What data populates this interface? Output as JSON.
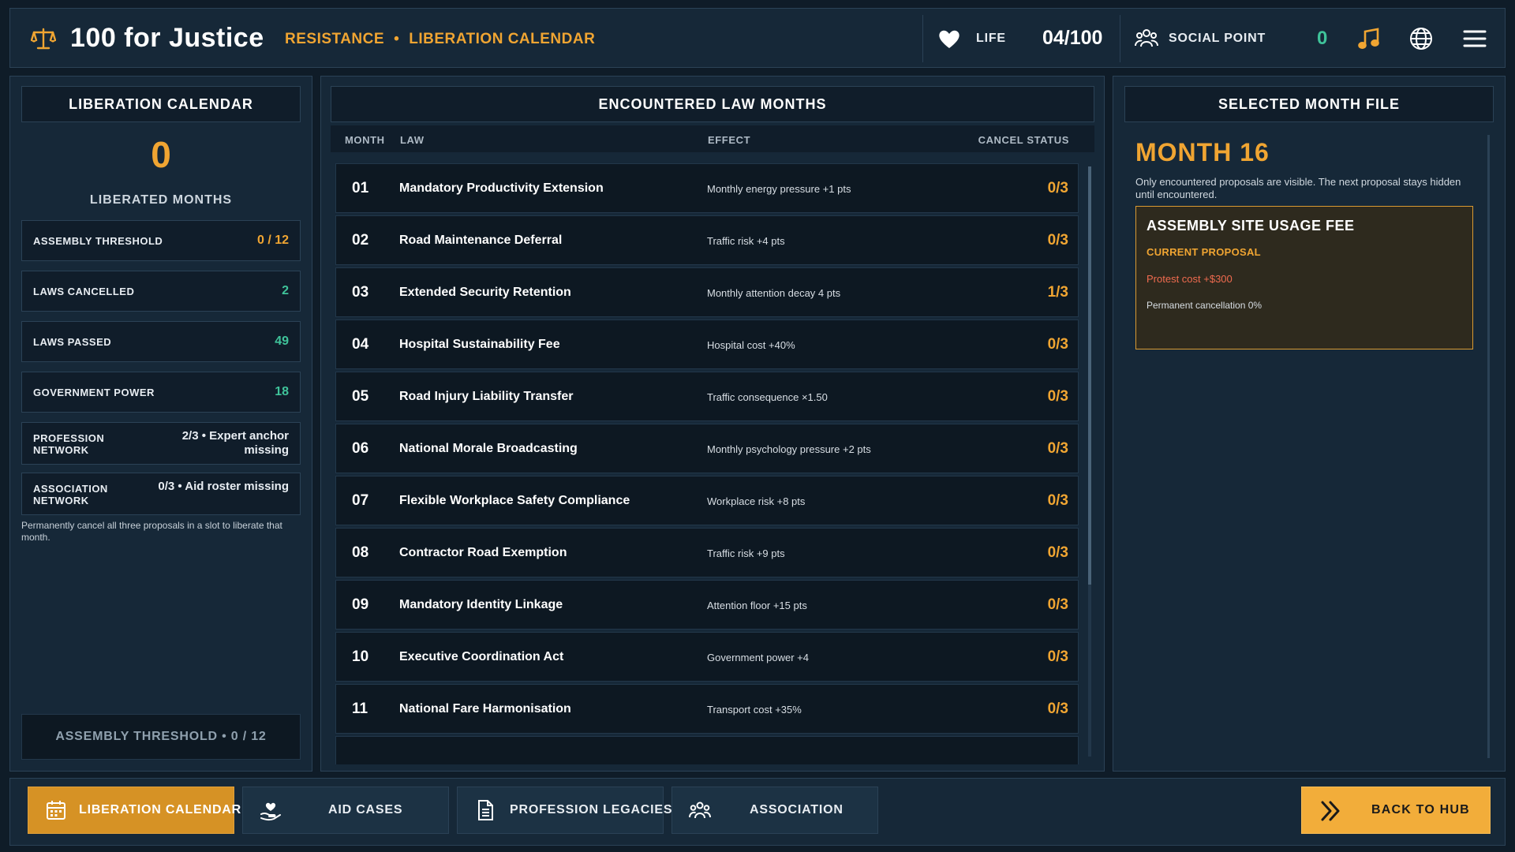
{
  "header": {
    "title": "100 for Justice",
    "breadcrumb": [
      "RESISTANCE",
      "LIBERATION CALENDAR"
    ],
    "breadcrumb_sep": "•",
    "life_label": "LIFE",
    "life_value": "04/100",
    "social_label": "SOCIAL POINT",
    "social_value": "0"
  },
  "left": {
    "title": "LIBERATION CALENDAR",
    "liberated_count": "0",
    "liberated_label": "LIBERATED MONTHS",
    "stats": [
      {
        "label": "ASSEMBLY THRESHOLD",
        "value": "0 / 12",
        "color": "#f0a532"
      },
      {
        "label": "LAWS CANCELLED",
        "value": "2",
        "color": "#3fc39a"
      },
      {
        "label": "LAWS PASSED",
        "value": "49",
        "color": "#3fc39a"
      },
      {
        "label": "GOVERNMENT POWER",
        "value": "18",
        "color": "#3fc39a"
      }
    ],
    "networks": [
      {
        "label": "PROFESSION NETWORK",
        "value": "2/3  •  Expert anchor missing"
      },
      {
        "label": "ASSOCIATION NETWORK",
        "value": "0/3  •  Aid roster missing"
      }
    ],
    "note": "Permanently cancel all three proposals in a slot to liberate that month.",
    "footer": "ASSEMBLY THRESHOLD • 0 / 12"
  },
  "middle": {
    "title": "ENCOUNTERED LAW MONTHS",
    "columns": {
      "month": "MONTH",
      "law": "LAW",
      "effect": "EFFECT",
      "status": "CANCEL STATUS"
    },
    "rows": [
      {
        "month": "01",
        "law": "Mandatory Productivity Extension",
        "effect": "Monthly energy pressure +1 pts",
        "status": "0/3"
      },
      {
        "month": "02",
        "law": "Road Maintenance Deferral",
        "effect": "Traffic risk +4 pts",
        "status": "0/3"
      },
      {
        "month": "03",
        "law": "Extended Security Retention",
        "effect": "Monthly attention decay 4 pts",
        "status": "1/3"
      },
      {
        "month": "04",
        "law": "Hospital Sustainability Fee",
        "effect": "Hospital cost +40%",
        "status": "0/3"
      },
      {
        "month": "05",
        "law": "Road Injury Liability Transfer",
        "effect": "Traffic consequence ×1.50",
        "status": "0/3"
      },
      {
        "month": "06",
        "law": "National Morale Broadcasting",
        "effect": "Monthly psychology pressure +2 pts",
        "status": "0/3"
      },
      {
        "month": "07",
        "law": "Flexible Workplace Safety Compliance",
        "effect": "Workplace risk +8 pts",
        "status": "0/3"
      },
      {
        "month": "08",
        "law": "Contractor Road Exemption",
        "effect": "Traffic risk +9 pts",
        "status": "0/3"
      },
      {
        "month": "09",
        "law": "Mandatory Identity Linkage",
        "effect": "Attention floor +15 pts",
        "status": "0/3"
      },
      {
        "month": "10",
        "law": "Executive Coordination Act",
        "effect": "Government power +4",
        "status": "0/3"
      },
      {
        "month": "11",
        "law": "National Fare Harmonisation",
        "effect": "Transport cost +35%",
        "status": "0/3"
      }
    ]
  },
  "right": {
    "title": "SELECTED MONTH FILE",
    "month": "MONTH 16",
    "note": "Only encountered proposals are visible. The next proposal stays hidden until encountered.",
    "proposal": {
      "title": "ASSEMBLY SITE USAGE FEE",
      "subtitle": "CURRENT PROPOSAL",
      "line1": "Protest cost +$300",
      "line2": "Permanent cancellation 0%"
    }
  },
  "nav": {
    "tabs": [
      {
        "label": "LIBERATION CALENDAR",
        "icon": "calendar-icon",
        "active": true
      },
      {
        "label": "AID CASES",
        "icon": "heart-hand-icon",
        "active": false
      },
      {
        "label": "PROFESSION LEGACIES",
        "icon": "document-icon",
        "active": false
      },
      {
        "label": "ASSOCIATION",
        "icon": "group-icon",
        "active": false
      }
    ],
    "back_label": "BACK TO HUB"
  },
  "colors": {
    "accent": "#f0a532",
    "positive": "#3fc39a",
    "danger": "#f06b4f",
    "panel": "#162838"
  }
}
